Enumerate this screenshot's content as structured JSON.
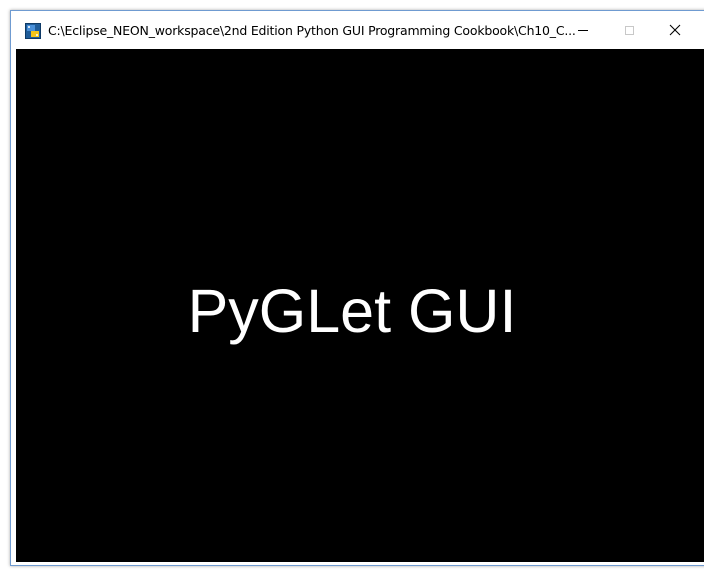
{
  "window": {
    "title": "C:\\Eclipse_NEON_workspace\\2nd Edition Python GUI Programming Cookbook\\Ch10_C...",
    "icon": "python-app-icon",
    "controls": {
      "minimize_icon": "minimize-icon",
      "maximize_icon": "maximize-icon",
      "maximize_enabled": false,
      "close_icon": "close-icon"
    }
  },
  "canvas": {
    "background": "#000000",
    "text": "PyGLet GUI",
    "text_color": "#ffffff"
  },
  "colors": {
    "window_border": "#6f9bd1",
    "titlebar": "#ffffff"
  }
}
